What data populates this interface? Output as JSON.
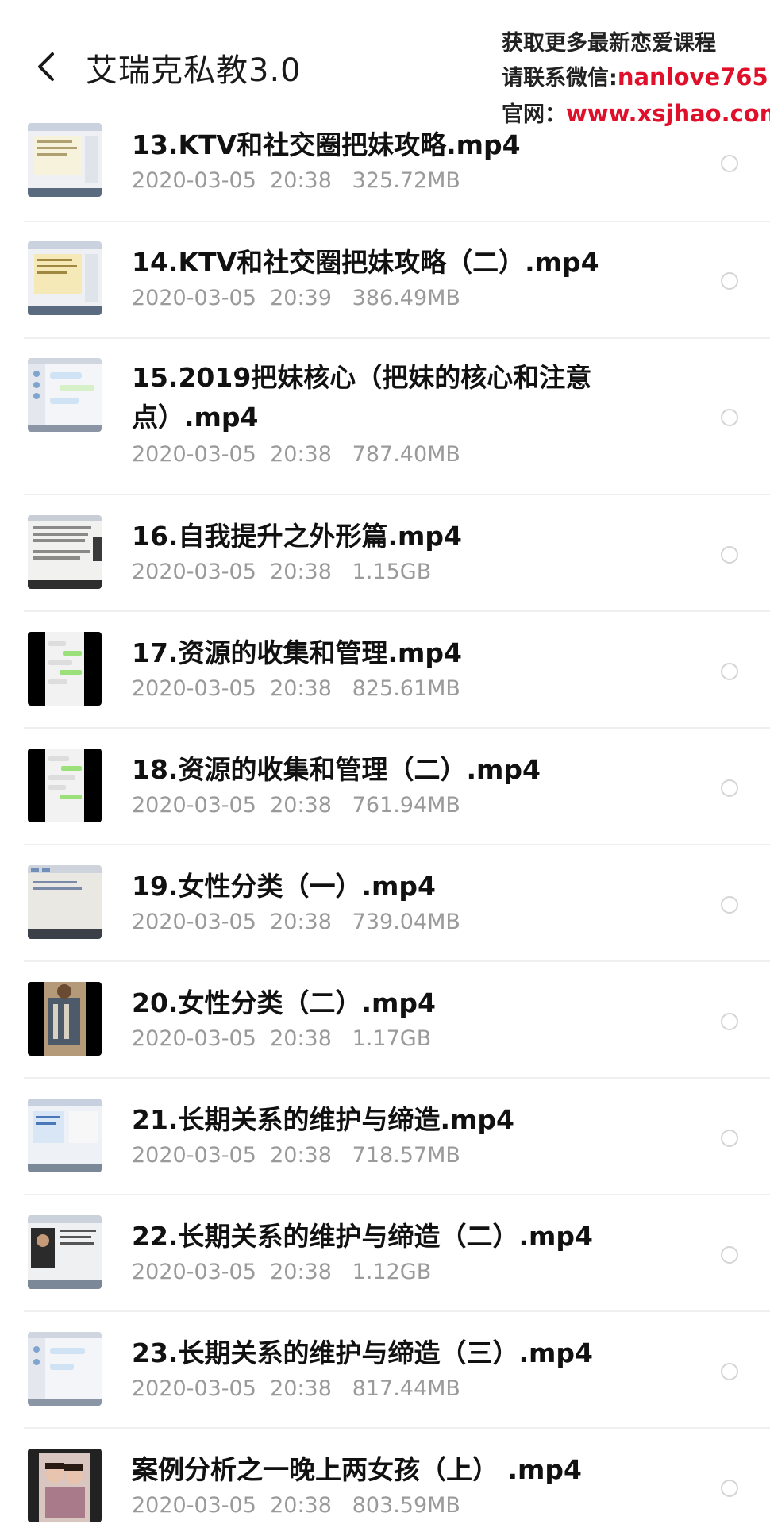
{
  "header": {
    "back_icon": "chevron-left-icon",
    "title": "艾瑞克私教3.0"
  },
  "promo": {
    "line1": "获取更多最新恋爱课程",
    "line2_prefix": "请联系微信:",
    "line2_accent": "nanlove765",
    "line3_prefix": "官网：",
    "line3_accent": "www.xsjhao.com",
    "accent_color": "#e0102a"
  },
  "files": [
    {
      "name": "13.KTV和社交圈把妹攻略.mp4",
      "date": "2020-03-05",
      "time": "20:38",
      "size": "325.72MB"
    },
    {
      "name": "14.KTV和社交圈把妹攻略（二）.mp4",
      "date": "2020-03-05",
      "time": "20:39",
      "size": "386.49MB"
    },
    {
      "name": "15.2019把妹核心（把妹的核心和注意点）.mp4",
      "name_line1": "15.2019把妹核心（把妹的核心和注意",
      "name_line2": "点）.mp4",
      "date": "2020-03-05",
      "time": "20:38",
      "size": "787.40MB"
    },
    {
      "name": "16.自我提升之外形篇.mp4",
      "date": "2020-03-05",
      "time": "20:38",
      "size": "1.15GB"
    },
    {
      "name": "17.资源的收集和管理.mp4",
      "date": "2020-03-05",
      "time": "20:38",
      "size": "825.61MB"
    },
    {
      "name": "18.资源的收集和管理（二）.mp4",
      "date": "2020-03-05",
      "time": "20:38",
      "size": "761.94MB"
    },
    {
      "name": "19.女性分类（一）.mp4",
      "date": "2020-03-05",
      "time": "20:38",
      "size": "739.04MB"
    },
    {
      "name": "20.女性分类（二）.mp4",
      "date": "2020-03-05",
      "time": "20:38",
      "size": "1.17GB"
    },
    {
      "name": "21.长期关系的维护与缔造.mp4",
      "date": "2020-03-05",
      "time": "20:38",
      "size": "718.57MB"
    },
    {
      "name": "22.长期关系的维护与缔造（二）.mp4",
      "date": "2020-03-05",
      "time": "20:38",
      "size": "1.12GB"
    },
    {
      "name": "23.长期关系的维护与缔造（三）.mp4",
      "date": "2020-03-05",
      "time": "20:38",
      "size": "817.44MB"
    },
    {
      "name": "案例分析之一晚上两女孩（上） .mp4",
      "date": "2020-03-05",
      "time": "20:38",
      "size": "803.59MB"
    }
  ]
}
